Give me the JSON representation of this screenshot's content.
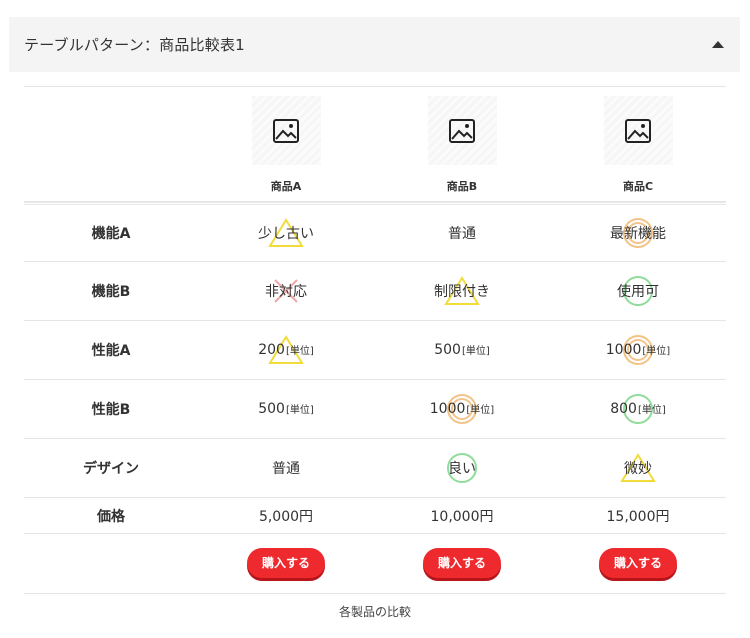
{
  "header": {
    "title": "テーブルパターン：商品比較表1",
    "toggle_icon": "caret-up-icon"
  },
  "products": [
    {
      "name": "商品A",
      "image_icon": "image-placeholder-icon"
    },
    {
      "name": "商品B",
      "image_icon": "image-placeholder-icon"
    },
    {
      "name": "商品C",
      "image_icon": "image-placeholder-icon"
    }
  ],
  "rows": [
    {
      "label": "機能A",
      "cells": [
        {
          "value": "少し古い",
          "unit": "",
          "mark": "triangle"
        },
        {
          "value": "普通",
          "unit": "",
          "mark": "none"
        },
        {
          "value": "最新機能",
          "unit": "",
          "mark": "double-circle"
        }
      ]
    },
    {
      "label": "機能B",
      "cells": [
        {
          "value": "非対応",
          "unit": "",
          "mark": "cross"
        },
        {
          "value": "制限付き",
          "unit": "",
          "mark": "triangle"
        },
        {
          "value": "使用可",
          "unit": "",
          "mark": "circle"
        }
      ]
    },
    {
      "label": "性能A",
      "cells": [
        {
          "value": "200",
          "unit": "[単位]",
          "mark": "triangle"
        },
        {
          "value": "500",
          "unit": "[単位]",
          "mark": "none"
        },
        {
          "value": "1000",
          "unit": "[単位]",
          "mark": "double-circle"
        }
      ]
    },
    {
      "label": "性能B",
      "cells": [
        {
          "value": "500",
          "unit": "[単位]",
          "mark": "none"
        },
        {
          "value": "1000",
          "unit": "[単位]",
          "mark": "double-circle"
        },
        {
          "value": "800",
          "unit": "[単位]",
          "mark": "circle"
        }
      ]
    },
    {
      "label": "デザイン",
      "cells": [
        {
          "value": "普通",
          "unit": "",
          "mark": "none"
        },
        {
          "value": "良い",
          "unit": "",
          "mark": "circle"
        },
        {
          "value": "微妙",
          "unit": "",
          "mark": "triangle"
        }
      ]
    }
  ],
  "price": {
    "label": "価格",
    "values": [
      "5,000円",
      "10,000円",
      "15,000円"
    ]
  },
  "buy_label": "購入する",
  "caption": "各製品の比較",
  "colors": {
    "buy_button": "#ee2a2f",
    "circle": "#8fdc9b",
    "double_circle": "#f3c489",
    "triangle": "#f2dc3a",
    "cross": "#f0a8a8",
    "header_bg": "#f4f4f4"
  }
}
